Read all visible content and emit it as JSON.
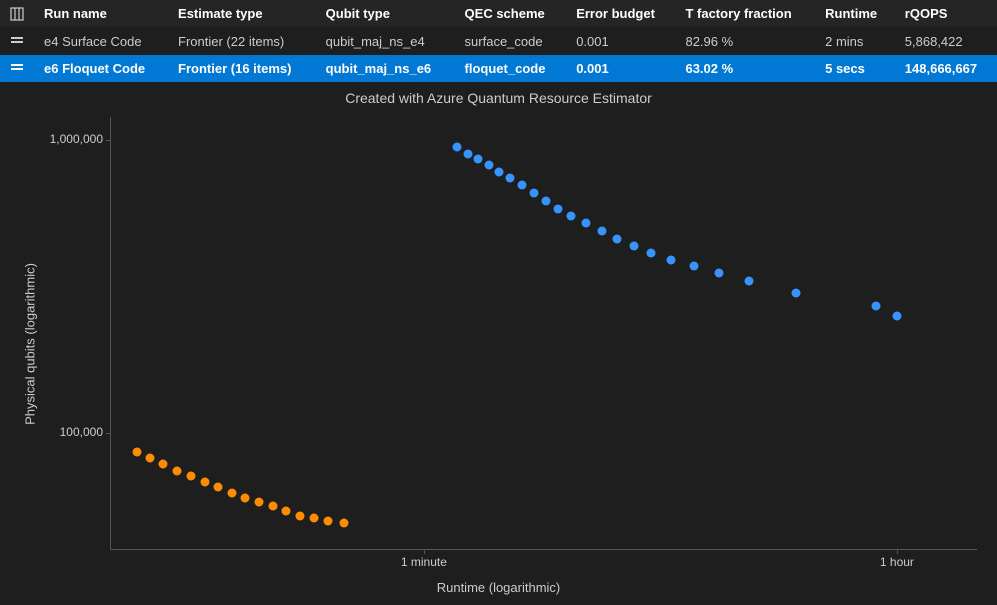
{
  "columns": [
    "Run name",
    "Estimate type",
    "Qubit type",
    "QEC scheme",
    "Error budget",
    "T factory fraction",
    "Runtime",
    "rQOPS"
  ],
  "rows": [
    {
      "selected": false,
      "cells": [
        "e4 Surface Code",
        "Frontier (22 items)",
        "qubit_maj_ns_e4",
        "surface_code",
        "0.001",
        "82.96 %",
        "2 mins",
        "5,868,422"
      ]
    },
    {
      "selected": true,
      "cells": [
        "e6 Floquet Code",
        "Frontier (16 items)",
        "qubit_maj_ns_e6",
        "floquet_code",
        "0.001",
        "63.02 %",
        "5 secs",
        "148,666,667"
      ]
    }
  ],
  "chart": {
    "title": "Created with Azure Quantum Resource Estimator",
    "ylabel": "Physical qubits (logarithmic)",
    "xlabel": "Runtime (logarithmic)",
    "y_ticks": [
      {
        "label": "1,000,000",
        "v": 1000000
      },
      {
        "label": "100,000",
        "v": 100000
      }
    ],
    "x_ticks": [
      {
        "label": "1 minute",
        "v": 60
      },
      {
        "label": "1 hour",
        "v": 3600
      }
    ]
  },
  "colors": {
    "series1": "#3794ff",
    "series2": "#ff8c00"
  },
  "chart_data": {
    "type": "scatter",
    "title": "Created with Azure Quantum Resource Estimator",
    "xlabel": "Runtime (logarithmic)",
    "ylabel": "Physical qubits (logarithmic)",
    "x_scale": "log",
    "y_scale": "log",
    "x_range_seconds": [
      4,
      7200
    ],
    "y_range": [
      40000,
      1200000
    ],
    "series": [
      {
        "name": "e4 Surface Code",
        "color": "#3794ff",
        "points": [
          {
            "runtime_s": 80,
            "qubits": 950000
          },
          {
            "runtime_s": 88,
            "qubits": 900000
          },
          {
            "runtime_s": 96,
            "qubits": 860000
          },
          {
            "runtime_s": 105,
            "qubits": 820000
          },
          {
            "runtime_s": 115,
            "qubits": 780000
          },
          {
            "runtime_s": 126,
            "qubits": 740000
          },
          {
            "runtime_s": 140,
            "qubits": 700000
          },
          {
            "runtime_s": 155,
            "qubits": 660000
          },
          {
            "runtime_s": 172,
            "qubits": 620000
          },
          {
            "runtime_s": 192,
            "qubits": 580000
          },
          {
            "runtime_s": 215,
            "qubits": 550000
          },
          {
            "runtime_s": 245,
            "qubits": 520000
          },
          {
            "runtime_s": 280,
            "qubits": 490000
          },
          {
            "runtime_s": 320,
            "qubits": 460000
          },
          {
            "runtime_s": 370,
            "qubits": 435000
          },
          {
            "runtime_s": 430,
            "qubits": 410000
          },
          {
            "runtime_s": 510,
            "qubits": 390000
          },
          {
            "runtime_s": 620,
            "qubits": 370000
          },
          {
            "runtime_s": 770,
            "qubits": 350000
          },
          {
            "runtime_s": 1000,
            "qubits": 330000
          },
          {
            "runtime_s": 1500,
            "qubits": 300000
          },
          {
            "runtime_s": 3000,
            "qubits": 270000
          },
          {
            "runtime_s": 3600,
            "qubits": 250000
          }
        ]
      },
      {
        "name": "e6 Floquet Code",
        "color": "#ff8c00",
        "points": [
          {
            "runtime_s": 5.0,
            "qubits": 86000
          },
          {
            "runtime_s": 5.6,
            "qubits": 82000
          },
          {
            "runtime_s": 6.3,
            "qubits": 78000
          },
          {
            "runtime_s": 7.1,
            "qubits": 74000
          },
          {
            "runtime_s": 8.0,
            "qubits": 71000
          },
          {
            "runtime_s": 9.0,
            "qubits": 68000
          },
          {
            "runtime_s": 10.1,
            "qubits": 65000
          },
          {
            "runtime_s": 11.4,
            "qubits": 62000
          },
          {
            "runtime_s": 12.8,
            "qubits": 60000
          },
          {
            "runtime_s": 14.4,
            "qubits": 58000
          },
          {
            "runtime_s": 16.2,
            "qubits": 56000
          },
          {
            "runtime_s": 18.2,
            "qubits": 54000
          },
          {
            "runtime_s": 20.6,
            "qubits": 52000
          },
          {
            "runtime_s": 23.2,
            "qubits": 51000
          },
          {
            "runtime_s": 26.2,
            "qubits": 50000
          },
          {
            "runtime_s": 30.0,
            "qubits": 49000
          }
        ]
      }
    ]
  }
}
